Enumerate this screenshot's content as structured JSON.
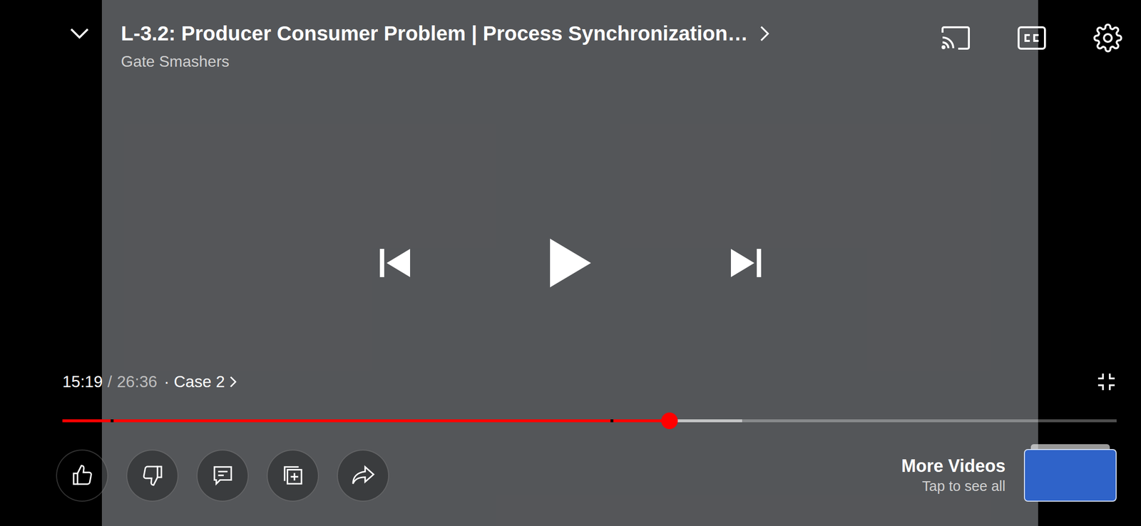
{
  "player": {
    "title": "L-3.2: Producer Consumer Problem | Process Synchronization…",
    "channel": "Gate Smashers",
    "paused": true,
    "current_time": "15:19",
    "separator": "/",
    "duration": "26:36",
    "chapter": "· Case 2",
    "progress": {
      "level": 0.576,
      "buffered": 0.645,
      "chapter_marks": [
        0.046,
        0.52
      ]
    }
  },
  "more_videos": {
    "title": "More Videos",
    "subtitle": "Tap to see all"
  }
}
